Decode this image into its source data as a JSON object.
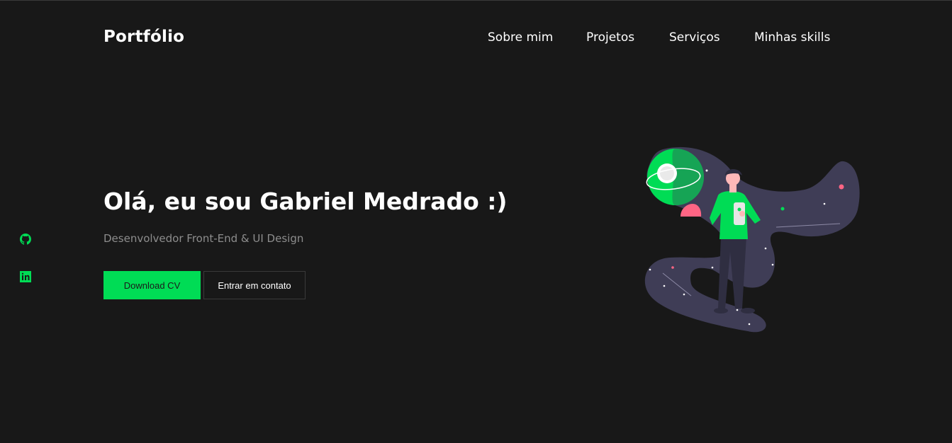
{
  "header": {
    "brand": "Portfólio",
    "nav": [
      {
        "label": "Sobre mim"
      },
      {
        "label": "Projetos"
      },
      {
        "label": "Serviços"
      },
      {
        "label": "Minhas skills"
      }
    ]
  },
  "social": [
    {
      "icon": "github-icon"
    },
    {
      "icon": "linkedin-icon"
    }
  ],
  "hero": {
    "title": "Olá, eu sou Gabriel Medrado :)",
    "subtitle": "Desenvolvedor Front-End & UI Design",
    "primary_button": "Download CV",
    "secondary_button": "Entrar em contato"
  },
  "illustration": {
    "icon": "person-with-phone-space-illustration"
  },
  "colors": {
    "background": "#181818",
    "accent": "#00dc55",
    "text": "#ffffff",
    "muted": "#8d8d8d",
    "blob": "#3f3d56",
    "pink": "#ff6584"
  }
}
